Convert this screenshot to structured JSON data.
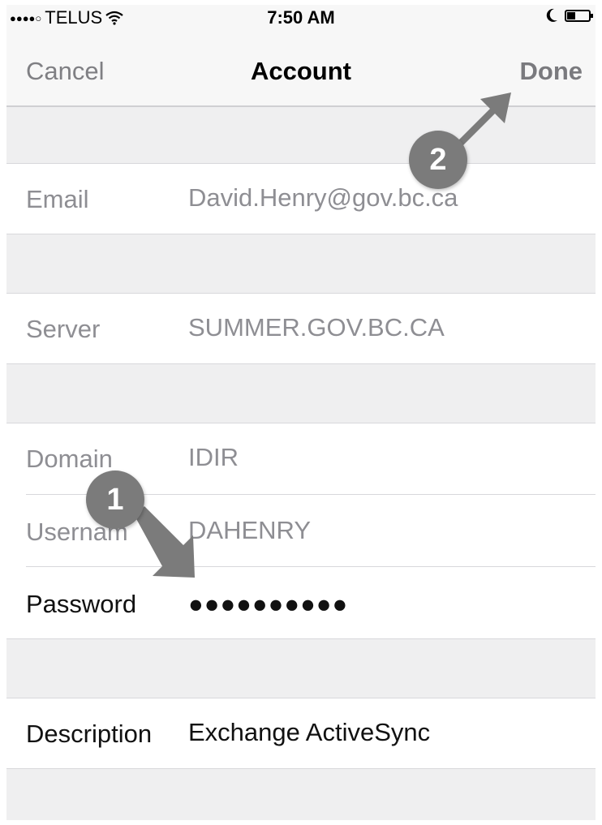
{
  "status_bar": {
    "carrier": "TELUS",
    "signal_dots": "●●●●○",
    "time": "7:50 AM",
    "moon_icon": "moon-icon",
    "battery_level": 0.4
  },
  "nav": {
    "cancel_label": "Cancel",
    "title": "Account",
    "done_label": "Done"
  },
  "fields": {
    "email": {
      "label": "Email",
      "value": "David.Henry@gov.bc.ca"
    },
    "server": {
      "label": "Server",
      "value": "SUMMER.GOV.BC.CA"
    },
    "domain": {
      "label": "Domain",
      "value": "IDIR"
    },
    "username": {
      "label": "Usernam",
      "value": "DAHENRY"
    },
    "password": {
      "label": "Password",
      "value": "●●●●●●●●●●"
    },
    "description": {
      "label": "Description",
      "value": "Exchange ActiveSync"
    }
  },
  "annotations": {
    "step1": "1",
    "step2": "2"
  },
  "colors": {
    "background": "#efeff0",
    "annotation": "#7b7b7b",
    "inactive_text": "#8e8e93",
    "active_text": "#111111"
  }
}
